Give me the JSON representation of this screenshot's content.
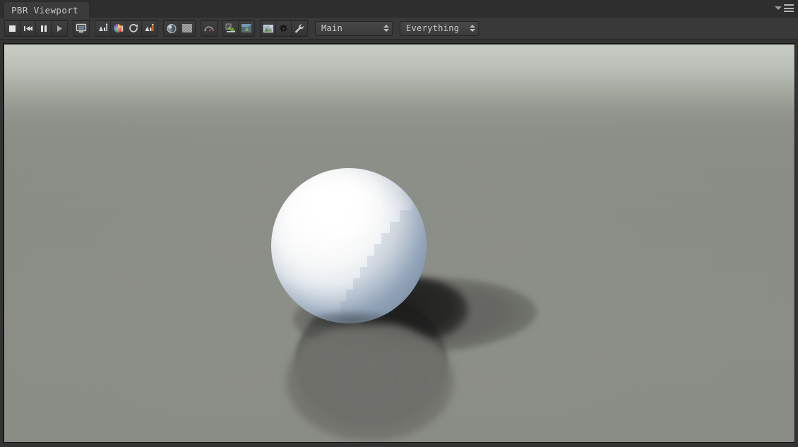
{
  "window": {
    "tab_label": "PBR Viewport",
    "panel_menu_icon": "hamburger-menu-icon",
    "panel_dropdown_icon": "chevron-down-icon"
  },
  "toolbar": {
    "groups": [
      {
        "name": "playback",
        "buttons": [
          {
            "name": "stop-button",
            "icon": "stop-icon",
            "tooltip": "Stop"
          },
          {
            "name": "rewind-button",
            "icon": "rewind-icon",
            "tooltip": "Rewind"
          },
          {
            "name": "pause-button",
            "icon": "pause-icon",
            "tooltip": "Pause"
          },
          {
            "name": "play-button",
            "icon": "play-icon",
            "tooltip": "Play"
          }
        ]
      },
      {
        "name": "display",
        "buttons": [
          {
            "name": "screen-button",
            "icon": "monitor-icon",
            "tooltip": "Display"
          }
        ]
      },
      {
        "name": "analysis",
        "buttons": [
          {
            "name": "stats-button",
            "icon": "chart-stats-icon",
            "tooltip": "Statistics"
          },
          {
            "name": "color-wheel-button",
            "icon": "color-wheel-icon",
            "tooltip": "Color"
          },
          {
            "name": "refresh-button",
            "icon": "refresh-icon",
            "tooltip": "Refresh"
          },
          {
            "name": "histogram-button",
            "icon": "histogram-icon",
            "tooltip": "Histogram"
          }
        ]
      },
      {
        "name": "shading",
        "buttons": [
          {
            "name": "sphere-shading-button",
            "icon": "shaded-sphere-icon",
            "tooltip": "Shading"
          },
          {
            "name": "checker-button",
            "icon": "checkerboard-icon",
            "tooltip": "Checker"
          }
        ]
      },
      {
        "name": "gauge",
        "buttons": [
          {
            "name": "gauge-button",
            "icon": "gauge-icon",
            "tooltip": "Performance"
          }
        ]
      },
      {
        "name": "scene-objects",
        "buttons": [
          {
            "name": "terrain-button",
            "icon": "terrain-icon",
            "tooltip": "Terrain"
          },
          {
            "name": "tree-button",
            "icon": "tree-icon",
            "tooltip": "Tree"
          }
        ]
      },
      {
        "name": "utilities",
        "buttons": [
          {
            "name": "image-button",
            "icon": "image-icon",
            "tooltip": "Image"
          },
          {
            "name": "settings-button",
            "icon": "gear-icon",
            "tooltip": "Settings"
          },
          {
            "name": "tools-button",
            "icon": "wrench-icon",
            "tooltip": "Tools"
          }
        ]
      }
    ],
    "camera_dropdown": {
      "name": "camera-select",
      "value": "Main",
      "options": [
        "Main"
      ]
    },
    "layers_dropdown": {
      "name": "layers-select",
      "value": "Everything",
      "options": [
        "Everything"
      ]
    }
  },
  "viewport": {
    "name": "render-viewport",
    "scene": {
      "objects": [
        "pbr-sphere",
        "ground-plane"
      ],
      "shadows": [
        "soft-shadow-ellipse",
        "main-shadow-ellipse",
        "core-shadow-overlap"
      ]
    }
  },
  "colors": {
    "panel_background": "#333333",
    "toolbar_background": "#393939",
    "tab_active": "#3b3b3b",
    "text": "#c8c8c8",
    "viewport_sky_top": "#c7ccc5",
    "viewport_floor": "#8a8c86",
    "sphere_lit": "#ffffff",
    "sphere_shadow": "#8fa0b4",
    "shadow_core": "#1b1c1a"
  }
}
